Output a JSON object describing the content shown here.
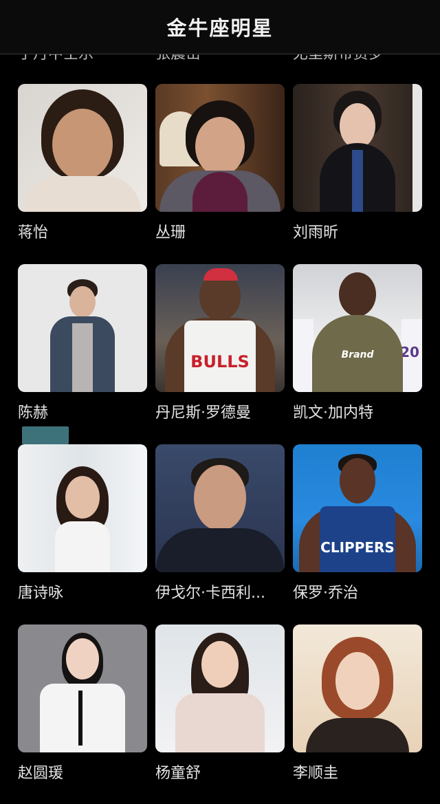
{
  "header": {
    "title": "金牛座明星"
  },
  "clipped_names": [
    "于丹中空乐",
    "张震岳",
    "尤里斯帝贾罗"
  ],
  "celebrities": [
    {
      "name": "蒋怡"
    },
    {
      "name": "丛珊"
    },
    {
      "name": "刘雨昕"
    },
    {
      "name": "陈赫"
    },
    {
      "name": "丹尼斯·罗德曼",
      "jersey": "BULLS"
    },
    {
      "name": "凯文·加内特",
      "shirt": "Brand",
      "number": "20"
    },
    {
      "name": "唐诗咏"
    },
    {
      "name": "伊戈尔·卡西利..."
    },
    {
      "name": "保罗·乔治",
      "jersey": "CLIPPERS"
    },
    {
      "name": "赵圆瑗"
    },
    {
      "name": "杨童舒"
    },
    {
      "name": "李顺圭"
    }
  ]
}
